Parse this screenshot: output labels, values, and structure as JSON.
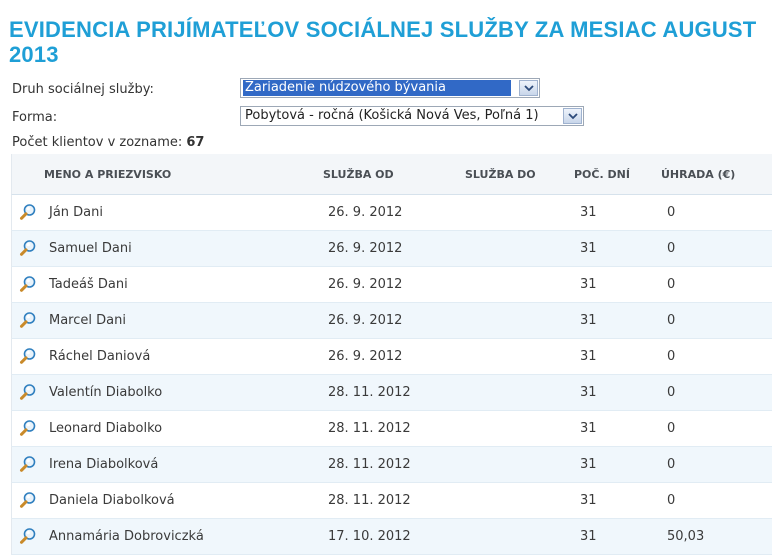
{
  "page": {
    "title": "EVIDENCIA PRIJÍMATEĽOV SOCIÁLNEJ SLUŽBY ZA MESIAC AUGUST 2013"
  },
  "filters": {
    "druh_label": "Druh sociálnej služby:",
    "druh_value": "Zariadenie núdzového bývania",
    "forma_label": "Forma:",
    "forma_value": "Pobytová - ročná (Košická Nová Ves, Poľná 1)",
    "pocet_label": "Počet klientov v zozname:",
    "pocet_value": "67"
  },
  "table": {
    "headers": {
      "name": "MENO A PRIEZVISKO",
      "od": "SLUŽBA OD",
      "do": "SLUŽBA DO",
      "dni": "POČ. DNÍ",
      "uhrada": "ÚHRADA (€)"
    },
    "rows": [
      {
        "name": "Ján Dani",
        "od": "26. 9. 2012",
        "do": "",
        "dni": "31",
        "uhrada": "0"
      },
      {
        "name": "Samuel Dani",
        "od": "26. 9. 2012",
        "do": "",
        "dni": "31",
        "uhrada": "0"
      },
      {
        "name": "Tadeáš Dani",
        "od": "26. 9. 2012",
        "do": "",
        "dni": "31",
        "uhrada": "0"
      },
      {
        "name": "Marcel Dani",
        "od": "26. 9. 2012",
        "do": "",
        "dni": "31",
        "uhrada": "0"
      },
      {
        "name": "Ráchel Daniová",
        "od": "26. 9. 2012",
        "do": "",
        "dni": "31",
        "uhrada": "0"
      },
      {
        "name": "Valentín Diabolko",
        "od": "28. 11. 2012",
        "do": "",
        "dni": "31",
        "uhrada": "0"
      },
      {
        "name": "Leonard Diabolko",
        "od": "28. 11. 2012",
        "do": "",
        "dni": "31",
        "uhrada": "0"
      },
      {
        "name": "Irena Diabolková",
        "od": "28. 11. 2012",
        "do": "",
        "dni": "31",
        "uhrada": "0"
      },
      {
        "name": "Daniela Diabolková",
        "od": "28. 11. 2012",
        "do": "",
        "dni": "31",
        "uhrada": "0"
      },
      {
        "name": "Annamária Dobroviczká",
        "od": "17. 10. 2012",
        "do": "",
        "dni": "31",
        "uhrada": "50,03"
      }
    ]
  },
  "colors": {
    "title": "#1f9fd6",
    "selected_option": "#3169c6",
    "row_alt": "#f0f7fc"
  },
  "icons": {
    "row_icon": "magnifier-icon",
    "dropdown": "chevron-down-icon"
  }
}
